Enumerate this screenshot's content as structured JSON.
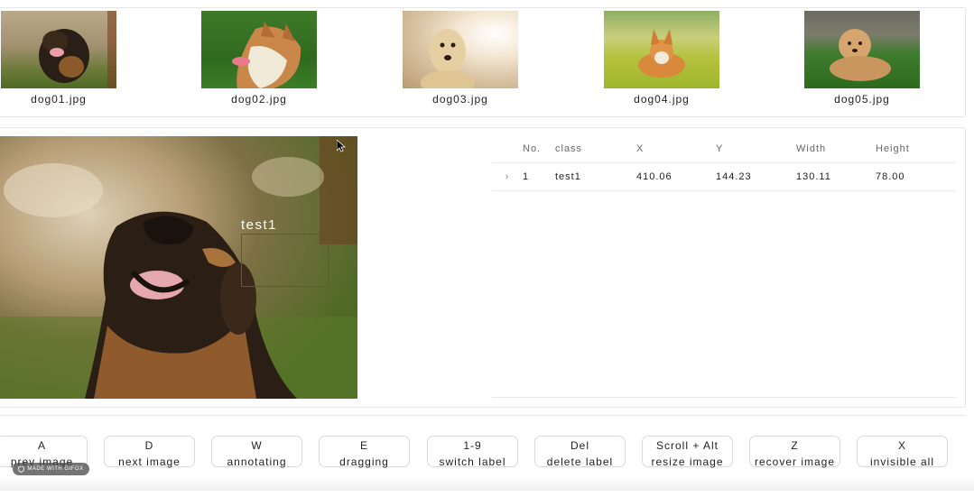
{
  "thumbnails": [
    {
      "name": "dog01.jpg"
    },
    {
      "name": "dog02.jpg"
    },
    {
      "name": "dog03.jpg"
    },
    {
      "name": "dog04.jpg"
    },
    {
      "name": "dog05.jpg"
    }
  ],
  "annotation": {
    "label": "test1"
  },
  "table": {
    "headers": {
      "no": "No.",
      "class": "class",
      "x": "X",
      "y": "Y",
      "width": "Width",
      "height": "Height"
    },
    "rows": [
      {
        "expand": "›",
        "no": "1",
        "class": "test1",
        "x": "410.06",
        "y": "144.23",
        "width": "130.11",
        "height": "78.00"
      }
    ]
  },
  "shortcuts": [
    {
      "key": "A",
      "desc": "prev image"
    },
    {
      "key": "D",
      "desc": "next image"
    },
    {
      "key": "W",
      "desc": "annotating"
    },
    {
      "key": "E",
      "desc": "dragging"
    },
    {
      "key": "1-9",
      "desc": "switch label"
    },
    {
      "key": "Del",
      "desc": "delete label"
    },
    {
      "key": "Scroll + Alt",
      "desc": "resize image"
    },
    {
      "key": "Z",
      "desc": "recover image"
    },
    {
      "key": "X",
      "desc": "invisible all"
    }
  ],
  "watermark": {
    "text": "MADE WITH GIFOX"
  }
}
